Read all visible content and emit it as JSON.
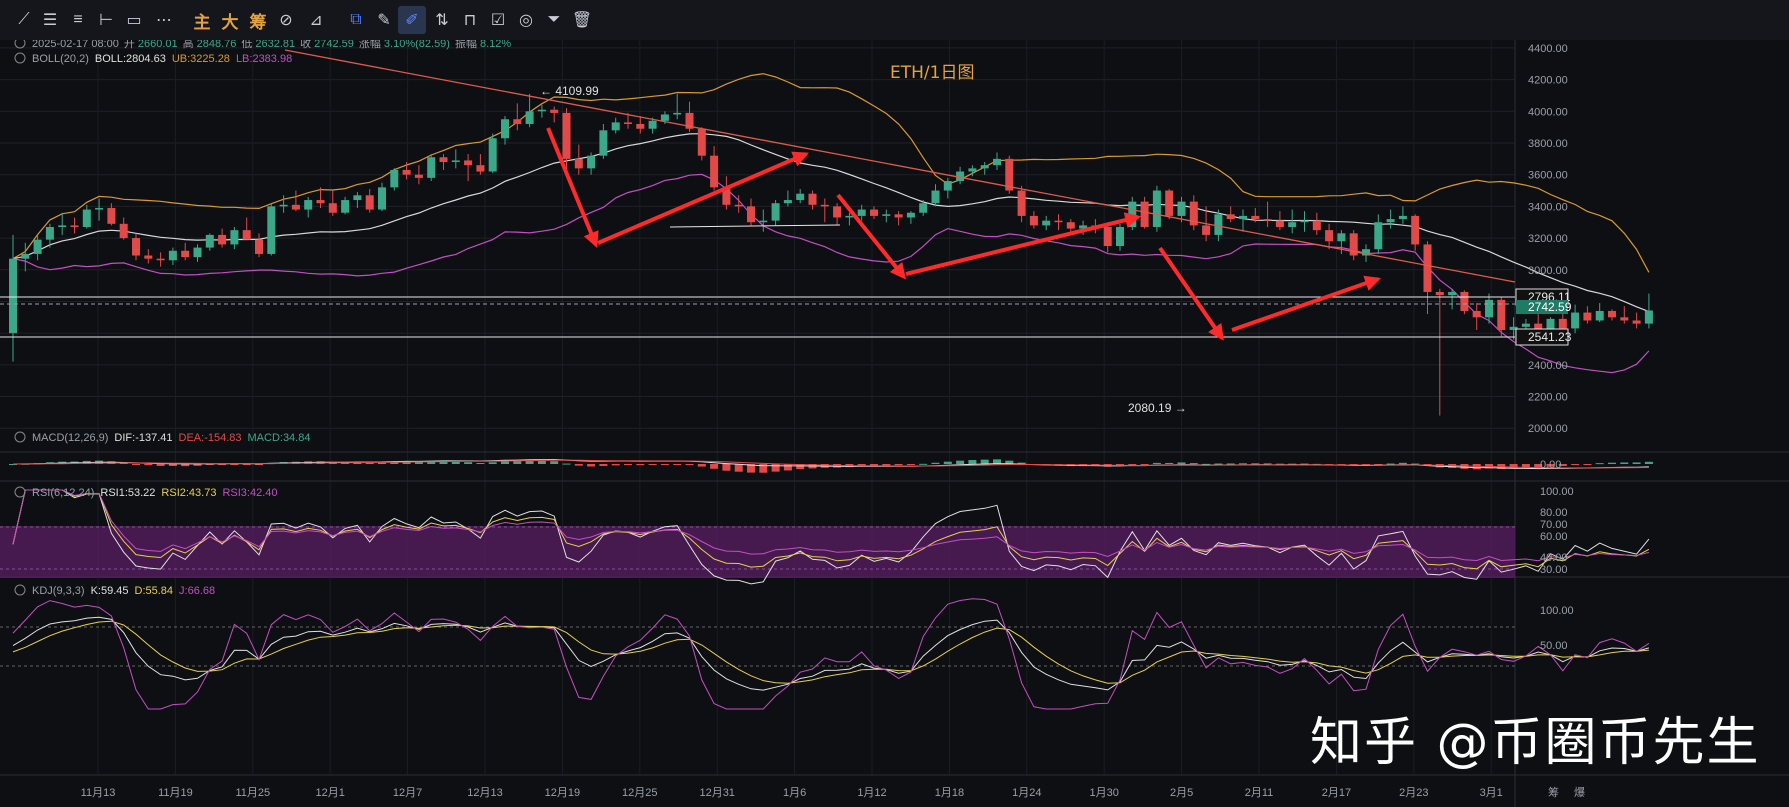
{
  "toolbar": {
    "cn_main": "主",
    "cn_big": "大",
    "cn_chip": "筹"
  },
  "header": {
    "datetime": "2025-02-17 08:00",
    "open_label": "开",
    "open": "2660.01",
    "high_label": "高",
    "high": "2848.76",
    "low_label": "低",
    "low": "2632.81",
    "close_label": "收",
    "close": "2742.59",
    "change_label": "涨幅",
    "change": "3.10%(82.59)",
    "amp_label": "振幅",
    "amp": "8.12%"
  },
  "boll": {
    "name": "BOLL(20,2)",
    "mid": "BOLL:2804.63",
    "ub": "UB:3225.28",
    "lb": "LB:2383.98"
  },
  "chart_title": "ETH/1日图",
  "macd_legend": {
    "name": "MACD(12,26,9)",
    "dif": "DIF:-137.41",
    "dea": "DEA:-154.83",
    "macd": "MACD:34.84"
  },
  "rsi_legend": {
    "name": "RSI(6,12,24)",
    "rsi1": "RSI1:53.22",
    "rsi2": "RSI2:43.73",
    "rsi3": "RSI3:42.40"
  },
  "kdj_legend": {
    "name": "KDJ(9,3,3)",
    "k": "K:59.45",
    "d": "D:55.84",
    "j": "J:66.68"
  },
  "watermark": "知乎 @币圈币先生",
  "colors": {
    "up": "#3ba88a",
    "down": "#e24a4a",
    "mid": "#d8d8d8",
    "ub": "#d99a2b",
    "lb": "#c34fc3",
    "arrow": "#ff2a2a",
    "trend": "#e05a4a"
  },
  "chart_data": {
    "type": "candlestick",
    "price_axis": {
      "ylim": [
        1850,
        4450
      ],
      "ticks": [
        "4400.00",
        "4200.00",
        "4000.00",
        "3800.00",
        "3600.00",
        "3400.00",
        "3200.00",
        "3000.00",
        "2800.00",
        "2600.00",
        "2400.00",
        "2200.00",
        "2000.00"
      ]
    },
    "x_labels": [
      "11月13",
      "11月19",
      "11月25",
      "12月1",
      "12月7",
      "12月13",
      "12月19",
      "12月25",
      "12月31",
      "1月6",
      "1月12",
      "1月18",
      "1月24",
      "1月30",
      "2月5",
      "2月11",
      "2月17",
      "2月23",
      "3月1"
    ],
    "x_tail_labels": [
      "筹",
      "爆"
    ],
    "price_lines": {
      "upper": "2796.11",
      "current": "2742.59",
      "lower": "2541.23"
    },
    "annotations": {
      "high": "← 4109.99",
      "low": "2080.19 →"
    },
    "candles": [
      [
        2600,
        3220,
        2420,
        3070
      ],
      [
        3070,
        3170,
        2990,
        3100
      ],
      [
        3100,
        3220,
        3060,
        3190
      ],
      [
        3190,
        3290,
        3140,
        3270
      ],
      [
        3270,
        3360,
        3220,
        3280
      ],
      [
        3280,
        3330,
        3230,
        3270
      ],
      [
        3270,
        3410,
        3260,
        3380
      ],
      [
        3380,
        3450,
        3310,
        3390
      ],
      [
        3390,
        3420,
        3280,
        3290
      ],
      [
        3290,
        3330,
        3190,
        3200
      ],
      [
        3200,
        3230,
        3060,
        3090
      ],
      [
        3090,
        3130,
        3040,
        3070
      ],
      [
        3070,
        3110,
        3020,
        3060
      ],
      [
        3060,
        3140,
        3030,
        3120
      ],
      [
        3120,
        3170,
        3060,
        3080
      ],
      [
        3080,
        3160,
        3050,
        3140
      ],
      [
        3140,
        3230,
        3120,
        3220
      ],
      [
        3220,
        3260,
        3140,
        3160
      ],
      [
        3160,
        3270,
        3130,
        3250
      ],
      [
        3250,
        3330,
        3190,
        3190
      ],
      [
        3190,
        3230,
        3080,
        3100
      ],
      [
        3100,
        3420,
        3090,
        3400
      ],
      [
        3400,
        3470,
        3360,
        3410
      ],
      [
        3410,
        3500,
        3370,
        3380
      ],
      [
        3380,
        3460,
        3330,
        3440
      ],
      [
        3440,
        3520,
        3390,
        3420
      ],
      [
        3420,
        3500,
        3340,
        3360
      ],
      [
        3360,
        3460,
        3350,
        3440
      ],
      [
        3440,
        3490,
        3390,
        3470
      ],
      [
        3470,
        3510,
        3360,
        3380
      ],
      [
        3380,
        3550,
        3370,
        3520
      ],
      [
        3520,
        3640,
        3500,
        3630
      ],
      [
        3630,
        3680,
        3570,
        3600
      ],
      [
        3600,
        3660,
        3540,
        3580
      ],
      [
        3580,
        3730,
        3560,
        3710
      ],
      [
        3710,
        3730,
        3630,
        3680
      ],
      [
        3680,
        3760,
        3640,
        3690
      ],
      [
        3690,
        3730,
        3560,
        3660
      ],
      [
        3660,
        3730,
        3600,
        3620
      ],
      [
        3620,
        3860,
        3610,
        3830
      ],
      [
        3830,
        3970,
        3790,
        3950
      ],
      [
        3950,
        4050,
        3880,
        3920
      ],
      [
        3920,
        4110,
        3900,
        4000
      ],
      [
        4000,
        4040,
        3960,
        4010
      ],
      [
        4010,
        4030,
        3930,
        3990
      ],
      [
        3990,
        4020,
        3630,
        3700
      ],
      [
        3700,
        3790,
        3600,
        3640
      ],
      [
        3640,
        3740,
        3600,
        3720
      ],
      [
        3720,
        3920,
        3700,
        3880
      ],
      [
        3880,
        3960,
        3860,
        3930
      ],
      [
        3930,
        3990,
        3890,
        3920
      ],
      [
        3920,
        3970,
        3860,
        3890
      ],
      [
        3890,
        3960,
        3860,
        3940
      ],
      [
        3940,
        4000,
        3920,
        3980
      ],
      [
        3980,
        4110,
        3950,
        3990
      ],
      [
        3990,
        4060,
        3870,
        3890
      ],
      [
        3890,
        3900,
        3690,
        3720
      ],
      [
        3720,
        3780,
        3500,
        3520
      ],
      [
        3520,
        3590,
        3380,
        3410
      ],
      [
        3410,
        3470,
        3360,
        3400
      ],
      [
        3400,
        3450,
        3280,
        3300
      ],
      [
        3300,
        3380,
        3240,
        3310
      ],
      [
        3310,
        3440,
        3280,
        3420
      ],
      [
        3420,
        3500,
        3400,
        3440
      ],
      [
        3440,
        3510,
        3420,
        3480
      ],
      [
        3480,
        3500,
        3380,
        3410
      ],
      [
        3410,
        3450,
        3300,
        3400
      ],
      [
        3400,
        3420,
        3280,
        3330
      ],
      [
        3330,
        3360,
        3280,
        3340
      ],
      [
        3340,
        3410,
        3310,
        3380
      ],
      [
        3380,
        3400,
        3320,
        3340
      ],
      [
        3340,
        3380,
        3300,
        3350
      ],
      [
        3350,
        3370,
        3280,
        3330
      ],
      [
        3330,
        3370,
        3290,
        3360
      ],
      [
        3360,
        3440,
        3340,
        3420
      ],
      [
        3420,
        3540,
        3400,
        3500
      ],
      [
        3500,
        3580,
        3450,
        3560
      ],
      [
        3560,
        3650,
        3540,
        3620
      ],
      [
        3620,
        3660,
        3590,
        3640
      ],
      [
        3640,
        3680,
        3600,
        3660
      ],
      [
        3660,
        3740,
        3630,
        3700
      ],
      [
        3700,
        3720,
        3480,
        3500
      ],
      [
        3500,
        3530,
        3300,
        3340
      ],
      [
        3340,
        3370,
        3260,
        3280
      ],
      [
        3280,
        3340,
        3250,
        3310
      ],
      [
        3310,
        3350,
        3250,
        3300
      ],
      [
        3300,
        3320,
        3220,
        3260
      ],
      [
        3260,
        3310,
        3220,
        3280
      ],
      [
        3280,
        3320,
        3230,
        3270
      ],
      [
        3270,
        3300,
        3110,
        3150
      ],
      [
        3150,
        3290,
        3120,
        3270
      ],
      [
        3270,
        3460,
        3250,
        3430
      ],
      [
        3430,
        3460,
        3260,
        3270
      ],
      [
        3270,
        3530,
        3240,
        3500
      ],
      [
        3500,
        3510,
        3320,
        3340
      ],
      [
        3340,
        3460,
        3300,
        3430
      ],
      [
        3430,
        3470,
        3250,
        3280
      ],
      [
        3280,
        3400,
        3180,
        3220
      ],
      [
        3220,
        3380,
        3180,
        3350
      ],
      [
        3350,
        3400,
        3300,
        3320
      ],
      [
        3320,
        3380,
        3240,
        3340
      ],
      [
        3340,
        3390,
        3300,
        3320
      ],
      [
        3320,
        3430,
        3270,
        3310
      ],
      [
        3310,
        3370,
        3250,
        3270
      ],
      [
        3270,
        3380,
        3230,
        3300
      ],
      [
        3300,
        3370,
        3240,
        3310
      ],
      [
        3310,
        3360,
        3220,
        3250
      ],
      [
        3250,
        3290,
        3130,
        3180
      ],
      [
        3180,
        3250,
        3100,
        3230
      ],
      [
        3230,
        3250,
        3060,
        3090
      ],
      [
        3090,
        3160,
        3050,
        3130
      ],
      [
        3130,
        3350,
        3100,
        3300
      ],
      [
        3300,
        3380,
        3260,
        3320
      ],
      [
        3320,
        3400,
        3290,
        3340
      ],
      [
        3340,
        3350,
        3120,
        3160
      ],
      [
        3160,
        3180,
        2720,
        2860
      ],
      [
        2860,
        2880,
        2080,
        2840
      ],
      [
        2840,
        2880,
        2750,
        2860
      ],
      [
        2860,
        2870,
        2720,
        2740
      ],
      [
        2740,
        2790,
        2620,
        2700
      ],
      [
        2700,
        2850,
        2660,
        2810
      ],
      [
        2810,
        2830,
        2580,
        2620
      ],
      [
        2620,
        2700,
        2560,
        2640
      ],
      [
        2640,
        2690,
        2580,
        2660
      ],
      [
        2660,
        2720,
        2560,
        2580
      ],
      [
        2580,
        2700,
        2540,
        2690
      ],
      [
        2690,
        2760,
        2620,
        2630
      ],
      [
        2630,
        2780,
        2600,
        2730
      ],
      [
        2730,
        2770,
        2660,
        2680
      ],
      [
        2680,
        2790,
        2670,
        2740
      ],
      [
        2740,
        2750,
        2680,
        2700
      ],
      [
        2700,
        2770,
        2660,
        2680
      ],
      [
        2680,
        2730,
        2630,
        2660
      ],
      [
        2660,
        2850,
        2630,
        2743
      ]
    ]
  }
}
